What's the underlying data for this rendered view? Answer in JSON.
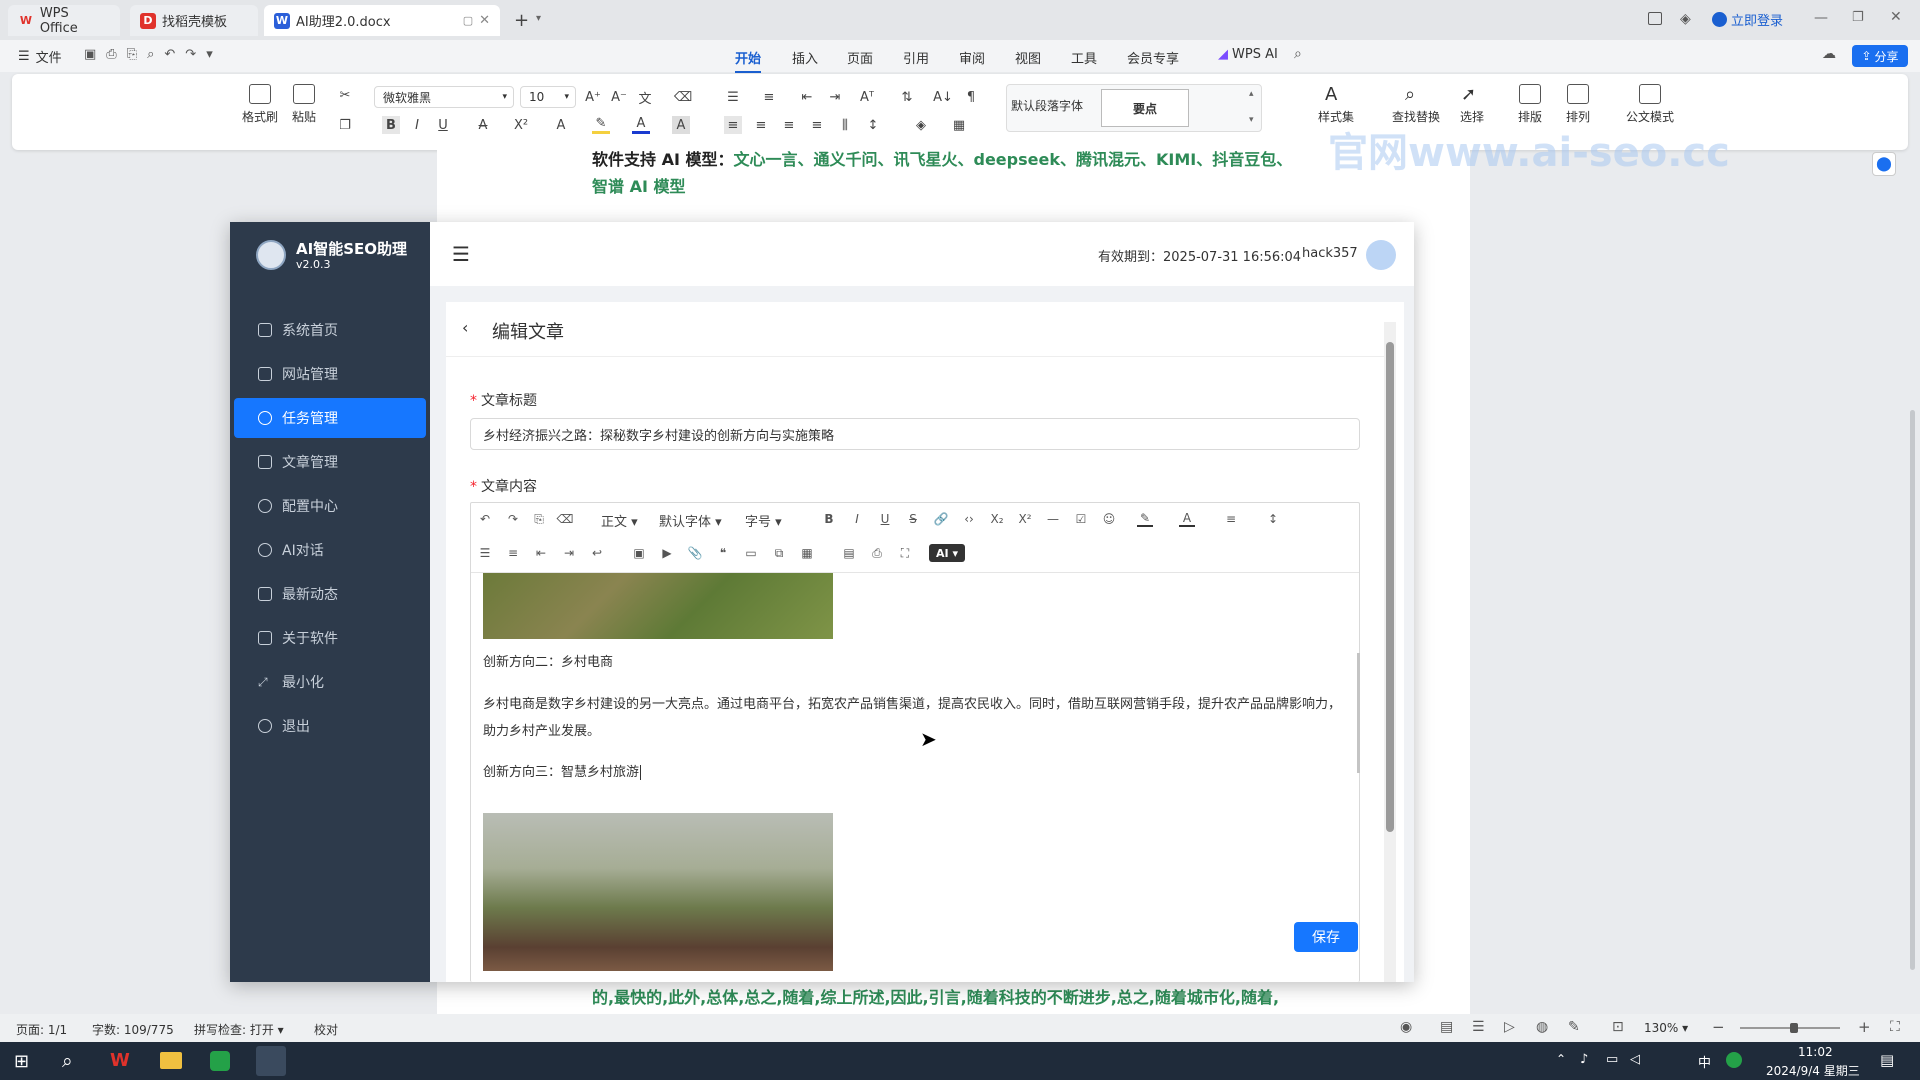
{
  "browser_tabs": [
    {
      "label": "WPS Office",
      "icon": "W",
      "color": "#e0322b"
    },
    {
      "label": "找稻壳模板",
      "icon": "D",
      "color": "#e0322b"
    },
    {
      "label": "AI助理2.0.docx",
      "icon": "W",
      "color": "#2b5fd9"
    }
  ],
  "titlebar": {
    "login": "立即登录"
  },
  "menubar": {
    "file": "文件",
    "items": [
      "开始",
      "插入",
      "页面",
      "引用",
      "审阅",
      "视图",
      "工具",
      "会员专享"
    ],
    "wps_ai": "WPS AI",
    "share": "分享"
  },
  "ribbon": {
    "format_painter": "格式刷",
    "paste": "粘贴",
    "font_name": "微软雅黑",
    "font_size": "10",
    "style_default": "默认段落字体",
    "style_keypoint": "要点",
    "styles": "样式集",
    "find_replace": "查找替换",
    "select": "选择",
    "layout": "排版",
    "arrange": "排列",
    "official_mode": "公文模式"
  },
  "doc": {
    "top_line_label": "软件支持 AI 模型：",
    "top_line_models": "文心一言、通义千问、讯飞星火、deepseek、腾讯混元、KIMI、抖音豆包、",
    "top_line_2": "智谱 AI 模型",
    "watermark": "官网www.ai-seo.cc",
    "bottom_line": "的,最快的,此外,总体,总之,随着,综上所述,因此,引言,随着科技的不断进步,总之,随着城市化,随着,"
  },
  "app": {
    "logo_title": "AI智能SEO助理",
    "version": "v2.0.3",
    "nav": [
      "系统首页",
      "网站管理",
      "任务管理",
      "文章管理",
      "配置中心",
      "AI对话",
      "最新动态",
      "关于软件",
      "最小化",
      "退出"
    ],
    "nav_icons": [
      "home-icon",
      "flag-icon",
      "clock-icon",
      "document-icon",
      "gear-icon",
      "chat-icon",
      "news-icon",
      "monitor-icon",
      "minimize-icon",
      "logout-icon"
    ],
    "active_index": 2,
    "expiry_label": "有效期到：2025-07-31 16:56:04",
    "username": "hack357",
    "page_title": "编辑文章",
    "title_label": "文章标题",
    "title_value": "乡村经济振兴之路：探秘数字乡村建设的创新方向与实施策略",
    "content_label": "文章内容",
    "toolbar": {
      "para": "正文",
      "font": "默认字体",
      "size": "字号",
      "ai": "AI"
    },
    "content": {
      "heading2": "创新方向二：乡村电商",
      "para2": "乡村电商是数字乡村建设的另一大亮点。通过电商平台，拓宽农产品销售渠道，提高农民收入。同时，借助互联网营销手段，提升农产品品牌影响力，助力乡村产业发展。",
      "heading3": "创新方向三：智慧乡村旅游"
    },
    "save": "保存"
  },
  "statusbar": {
    "page": "页面: 1/1",
    "words": "字数: 109/775",
    "spell": "拼写检查: 打开",
    "proof": "校对",
    "zoom": "130%"
  },
  "taskbar": {
    "ime": "中",
    "time": "11:02",
    "date": "2024/9/4 星期三"
  }
}
